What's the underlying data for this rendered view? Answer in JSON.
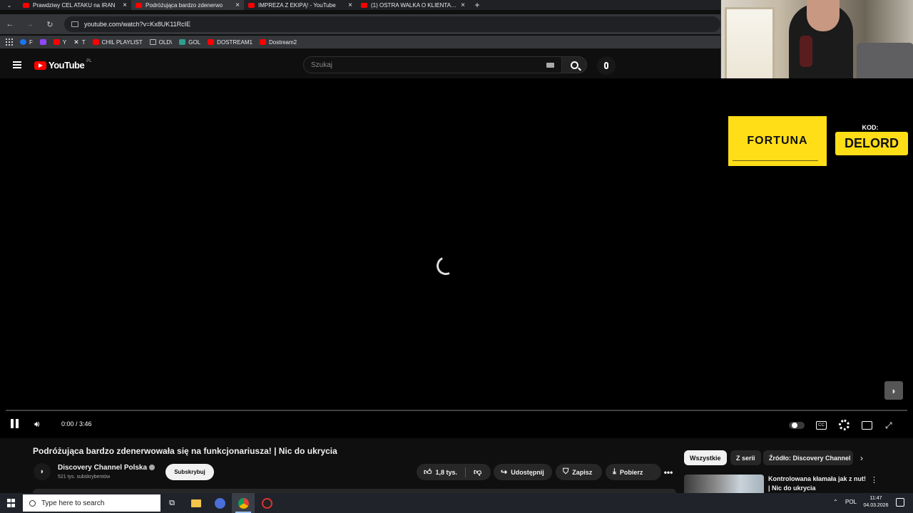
{
  "browser": {
    "tabs": [
      {
        "title": "Prawdziwy CEL ATAKU na IRAN",
        "active": false
      },
      {
        "title": "Podróżująca bardzo zdenerwo",
        "active": true
      },
      {
        "title": "IMPREZA Z EKIPĄ! - YouTube",
        "active": false
      },
      {
        "title": "(1) OSTRA WALKA O KLIENTA, C",
        "active": false
      }
    ],
    "url": "youtube.com/watch?v=Kx8UK11RcIE",
    "bookmarks": [
      "F",
      "",
      "Y",
      "T",
      "CHIL PLAYLIST",
      "OLD\\",
      "GOL",
      "DOSTREAM1",
      "Dostream2"
    ]
  },
  "youtube": {
    "logo": "YouTube",
    "country": "PL",
    "search_placeholder": "Szukaj"
  },
  "player": {
    "time": "0:00 / 3:46",
    "progress_fraction": 0.0,
    "loading": true
  },
  "video": {
    "title": "Podróżująca bardzo zdenerwowała się na funkcjonariusza! | Nic do ukrycia",
    "channel": "Discovery Channel Polska",
    "subscribers": "521 tys. subskrybentów",
    "subscribe_label": "Subskrybuj",
    "likes": "1,8 tys.",
    "share_label": "Udostępnij",
    "save_label": "Zapisz",
    "download_label": "Pobierz"
  },
  "overlay": {
    "sponsor": "FORTUNA",
    "code_label": "KOD:",
    "code": "DELORD"
  },
  "sidebar": {
    "chips": [
      "Wszystkie",
      "Z serii",
      "Źródło: Discovery Channel"
    ],
    "rec_title": "Kontrolowana kłamała jak z nut! | Nic do ukrycia"
  },
  "taskbar": {
    "search_placeholder": "Type here to search",
    "lang": "POL",
    "time": "11:47",
    "date": "04.03.2026"
  },
  "colors": {
    "accent": "#ff0000",
    "sponsor": "#ffde17"
  }
}
